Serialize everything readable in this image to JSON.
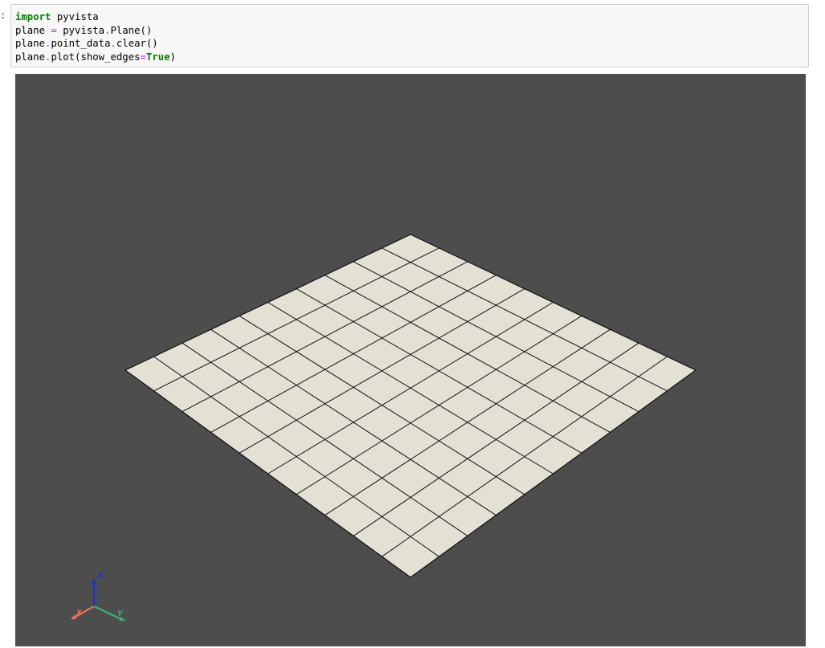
{
  "prompt": ":",
  "code": {
    "lines": [
      [
        {
          "t": "import",
          "c": "kw"
        },
        {
          "t": " pyvista",
          "c": ""
        }
      ],
      [
        {
          "t": "plane ",
          "c": ""
        },
        {
          "t": "=",
          "c": "op"
        },
        {
          "t": " pyvista",
          "c": ""
        },
        {
          "t": ".",
          "c": "op"
        },
        {
          "t": "Plane()",
          "c": ""
        }
      ],
      [
        {
          "t": "plane",
          "c": ""
        },
        {
          "t": ".",
          "c": "op"
        },
        {
          "t": "point_data",
          "c": ""
        },
        {
          "t": ".",
          "c": "op"
        },
        {
          "t": "clear()",
          "c": ""
        }
      ],
      [
        {
          "t": "plane",
          "c": ""
        },
        {
          "t": ".",
          "c": "op"
        },
        {
          "t": "plot(show_edges",
          "c": ""
        },
        {
          "t": "=",
          "c": "op"
        },
        {
          "t": "True",
          "c": "const"
        },
        {
          "t": ")",
          "c": ""
        }
      ]
    ]
  },
  "render": {
    "background": "#4d4d4d",
    "plane_color": "#e4e0d4",
    "edge_color": "#111111",
    "grid_divisions": 10,
    "axes": {
      "x": {
        "label": "X",
        "color": "#e8735a"
      },
      "y": {
        "label": "Y",
        "color": "#3cb371"
      },
      "z": {
        "label": "Z",
        "color": "#1e2fd6"
      }
    }
  }
}
